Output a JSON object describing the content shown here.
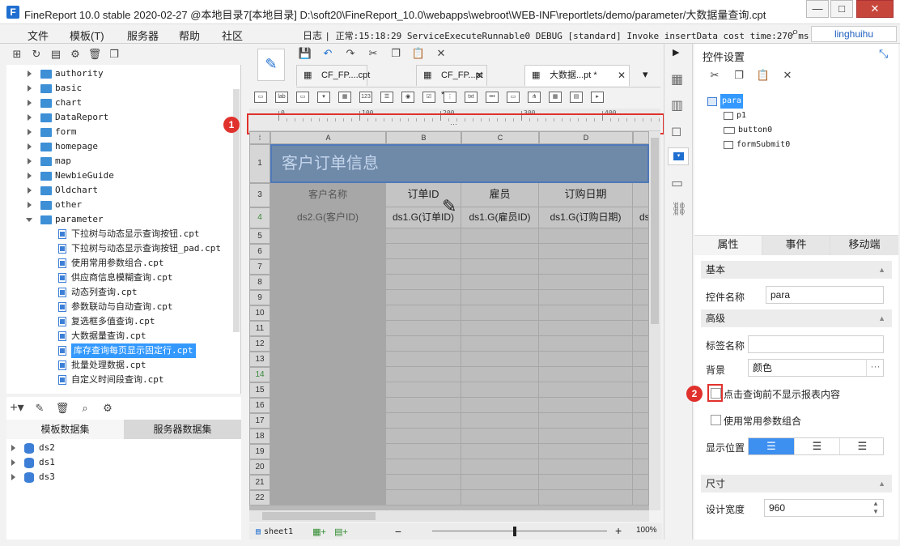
{
  "window": {
    "title": "FineReport 10.0 stable 2020-02-27 @本地目录7[本地目录]    D:\\soft20\\FineReport_10.0\\webapps\\webroot\\WEB-INF\\reportlets/demo/parameter/大数据量查询.cpt",
    "minimize": "—",
    "maximize": "□",
    "close": "✕"
  },
  "menu": {
    "items": [
      "文件",
      "模板(T)",
      "服务器",
      "帮助",
      "社区"
    ],
    "log_label": "日志",
    "log_text": "| 正常:15:18:29 ServiceExecuteRunnable0 DEBUG [standard] Invoke insertData cost time:270 ms",
    "user": "linghuihu"
  },
  "tree": {
    "folders": [
      "authority",
      "basic",
      "chart",
      "DataReport",
      "form",
      "homepage",
      "map",
      "NewbieGuide",
      "Oldchart",
      "other"
    ],
    "open_folder": "parameter",
    "files": [
      "下拉树与动态显示查询按钮.cpt",
      "下拉树与动态显示查询按钮_pad.cpt",
      "使用常用参数组合.cpt",
      "供应商信息模糊查询.cpt",
      "动态列查询.cpt",
      "参数联动与自动查询.cpt",
      "复选框多值查询.cpt",
      "大数据量查询.cpt",
      "库存查询每页显示固定行.cpt",
      "批量处理数据.cpt",
      "自定义时间段查询.cpt"
    ],
    "selected_file": "库存查询每页显示固定行.cpt"
  },
  "datasets": {
    "tab_template": "模板数据集",
    "tab_server": "服务器数据集",
    "items": [
      "ds2",
      "ds1",
      "ds3"
    ]
  },
  "file_tabs": [
    {
      "label": "CF_FP....cpt"
    },
    {
      "label": "CF_FP...pt *"
    },
    {
      "label": "大数据...pt *"
    }
  ],
  "ruler": {
    "labels": [
      "0",
      "100",
      "200",
      "300",
      "400"
    ],
    "handle": "···"
  },
  "sheet": {
    "columns": [
      "A",
      "B",
      "C",
      "D"
    ],
    "title": "客户订单信息",
    "headers": [
      "客户名称",
      "订单ID",
      "雇员",
      "订购日期"
    ],
    "data_row": [
      "ds2.G(客户ID)",
      "ds1.G(订单ID)",
      "ds1.G(雇员ID)",
      "ds1.G(订购日期)",
      "ds"
    ],
    "row_numbers": [
      "1",
      "3",
      "4",
      "5",
      "6",
      "7",
      "8",
      "9",
      "10",
      "11",
      "12",
      "13",
      "14",
      "15",
      "16",
      "17",
      "18",
      "19",
      "20",
      "21",
      "22"
    ],
    "tab": "sheet1",
    "zoom": "100%"
  },
  "right": {
    "header": "控件设置",
    "widget_tree": {
      "root": "para",
      "children": [
        "p1",
        "button0",
        "formSubmit0"
      ]
    },
    "tabs": [
      "属性",
      "事件",
      "移动端"
    ],
    "sections": {
      "basic": "基本",
      "advanced": "高级",
      "size": "尺寸"
    },
    "fields": {
      "name_label": "控件名称",
      "name_value": "para",
      "tag_label": "标签名称",
      "tag_value": "",
      "bg_label": "背景",
      "bg_value": "颜色",
      "chk1": "点击查询前不显示报表内容",
      "chk2": "使用常用参数组合",
      "pos_label": "显示位置",
      "width_label": "设计宽度",
      "width_value": "960"
    }
  },
  "markers": [
    "1",
    "2"
  ]
}
